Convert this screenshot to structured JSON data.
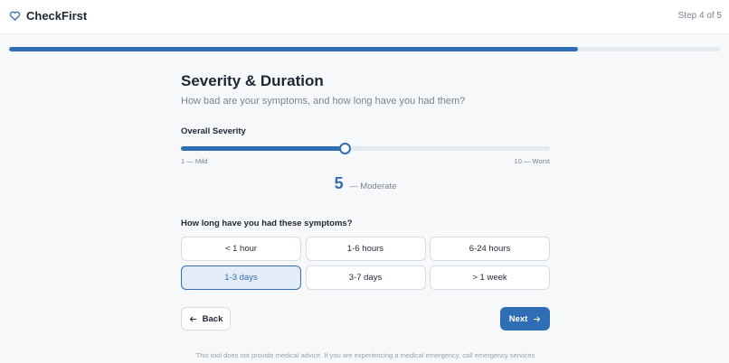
{
  "header": {
    "brand": "CheckFirst",
    "step_label": "Step 4 of 5"
  },
  "progress": {
    "fraction": 0.8
  },
  "main": {
    "title": "Severity & Duration",
    "subtitle": "How bad are your symptoms, and how long have you had them?"
  },
  "severity": {
    "label": "Overall Severity",
    "min": 1,
    "max": 10,
    "value": 5,
    "value_text": "5",
    "descriptor": "— Moderate",
    "min_label": "1 — Mild",
    "max_label": "10 — Worst"
  },
  "duration": {
    "label": "How long have you had these symptoms?",
    "options": [
      "< 1 hour",
      "1-6 hours",
      "6-24 hours",
      "1-3 days",
      "3-7 days",
      "> 1 week"
    ],
    "selected": "1-3 days"
  },
  "nav": {
    "back_label": "Back",
    "next_label": "Next"
  },
  "footer": {
    "disclaimer": "This tool does not provide medical advice. If you are experiencing a medical emergency, call emergency services immediately."
  },
  "colors": {
    "accent": "#2f6db5",
    "selected_bg": "#e3ecf8"
  },
  "icons": {
    "brand": "heart-icon",
    "back": "arrow-left-icon",
    "next": "arrow-right-icon"
  }
}
